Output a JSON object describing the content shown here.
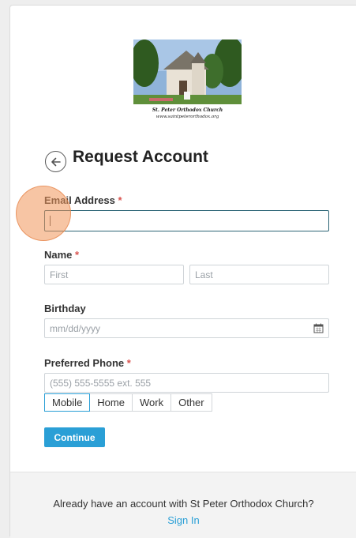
{
  "logo": {
    "caption_line1": "St. Peter Orthodox Church",
    "caption_line2": "www.saintpeterorthodox.org"
  },
  "header": {
    "title": "Request Account"
  },
  "form": {
    "email": {
      "label": "Email Address",
      "required_mark": "*",
      "value": ""
    },
    "name": {
      "label": "Name",
      "required_mark": "*",
      "first_placeholder": "First",
      "last_placeholder": "Last"
    },
    "birthday": {
      "label": "Birthday",
      "placeholder": "mm/dd/yyyy"
    },
    "phone": {
      "label": "Preferred Phone",
      "required_mark": "*",
      "placeholder": "(555) 555-5555 ext. 555",
      "types": [
        "Mobile",
        "Home",
        "Work",
        "Other"
      ],
      "selected": "Mobile"
    },
    "continue_label": "Continue"
  },
  "footer": {
    "question": "Already have an account with St Peter Orthodox Church?",
    "signin_label": "Sign In"
  },
  "colors": {
    "accent": "#2a9fd6",
    "required": "#d9534f",
    "focus_border": "#2d6576"
  }
}
